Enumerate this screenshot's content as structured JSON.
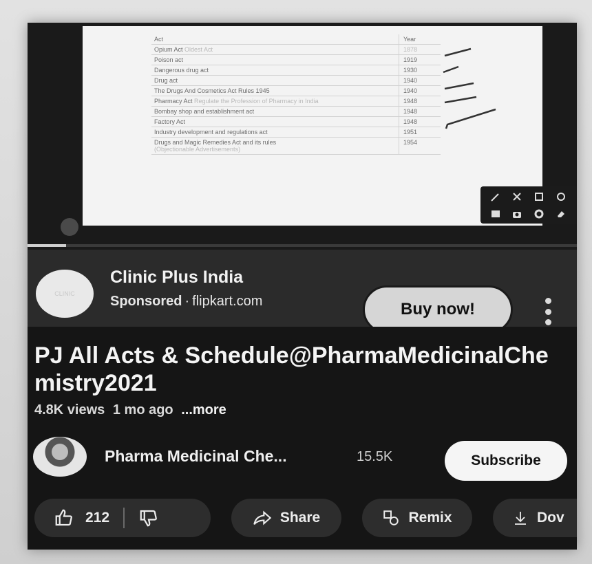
{
  "video": {
    "slide": {
      "header": {
        "act": "Act",
        "year": "Year"
      },
      "rows": [
        {
          "act": "Opium Act",
          "note": "Oldest Act",
          "year": "1878"
        },
        {
          "act": "Poison act",
          "note": "",
          "year": "1919"
        },
        {
          "act": "Dangerous drug act",
          "note": "",
          "year": "1930"
        },
        {
          "act": "Drug act",
          "note": "",
          "year": "1940"
        },
        {
          "act": "The Drugs And Cosmetics Act Rules 1945",
          "note": "",
          "year": "1940"
        },
        {
          "act": "Pharmacy Act",
          "note": "Regulate the Profession of Pharmacy in India",
          "year": "1948"
        },
        {
          "act": "Bombay shop and establishment act",
          "note": "",
          "year": "1948"
        },
        {
          "act": "Factory Act",
          "note": "",
          "year": "1948"
        },
        {
          "act": "Industry development and regulations act",
          "note": "",
          "year": "1951"
        },
        {
          "act": "Drugs and Magic Remedies Act and its rules",
          "note": "(Objectionable Advertisements)",
          "year": "1954"
        }
      ]
    },
    "progress_fraction": 0.07
  },
  "ad": {
    "avatar_text": "CLINIC",
    "title": "Clinic Plus India",
    "sponsored_label": "Sponsored",
    "separator": "·",
    "domain": "flipkart.com",
    "cta_label": "Buy now!"
  },
  "video_info": {
    "title": "PJ All Acts & Schedule@PharmaMedicinalChemistry2021",
    "views": "4.8K views",
    "age": "1 mo ago",
    "more_label": "...more"
  },
  "channel": {
    "name": "Pharma Medicinal Che...",
    "subscribers": "15.5K",
    "subscribe_label": "Subscribe"
  },
  "actions": {
    "like_count": "212",
    "share_label": "Share",
    "remix_label": "Remix",
    "download_label": "Dov"
  },
  "colors": {
    "background": "#151515",
    "pill": "#2d2d2d",
    "subscribe_bg": "#f5f5f5",
    "buy_bg": "#d6d6d6"
  }
}
